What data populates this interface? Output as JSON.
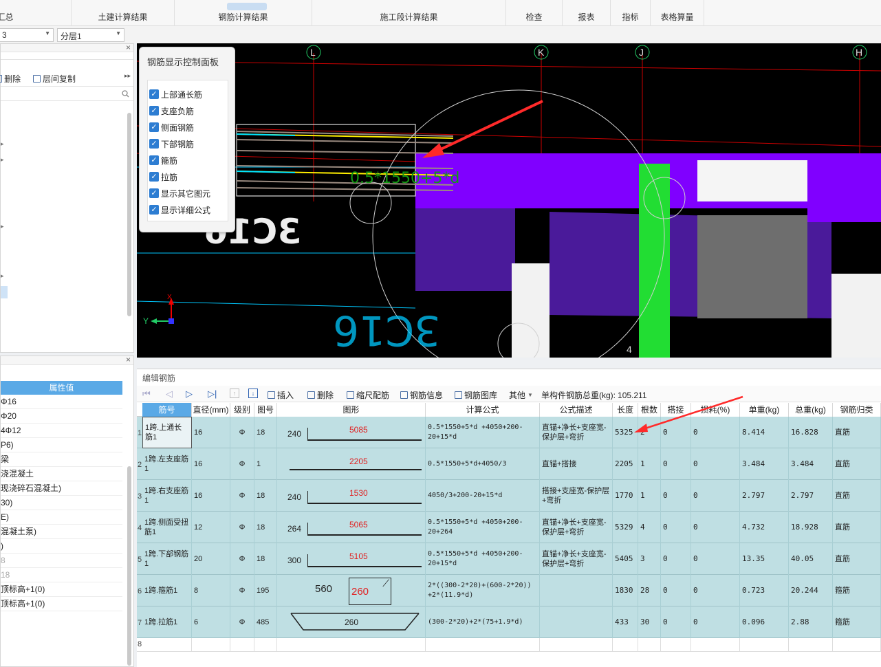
{
  "ribbon": {
    "tabs": [
      "汇总",
      "土建计算结果",
      "钢筋计算结果",
      "施工段计算结果",
      "检查",
      "报表",
      "指标",
      "表格算量"
    ]
  },
  "toolbar2": {
    "floor_select": "3",
    "layer_select": "分层1"
  },
  "left_panel_top": {
    "delete_label": "删除",
    "copy_label": "层间复制"
  },
  "left_panel_bottom": {
    "header": "属性值",
    "values": [
      "Φ16",
      "Φ20",
      "4Φ12",
      "P6)",
      "梁",
      "浇混凝土",
      "现浇碎石混凝土)",
      "30)",
      "E)",
      "混凝土泵)",
      ")",
      "8",
      "18",
      "顶标高+1(0)",
      "顶标高+1(0)"
    ]
  },
  "viewport": {
    "axis_labels": [
      "L",
      "K",
      "J",
      "H"
    ],
    "rebar_text_1": "3C16",
    "rebar_text_2": "3C16",
    "annot_green": "0.5*1550+5*d",
    "axis_y": "Y",
    "axis_x": "X",
    "bottom_label": "4"
  },
  "control_panel": {
    "title": "钢筋显示控制面板",
    "items": [
      "上部通长筋",
      "支座负筋",
      "侧面钢筋",
      "下部钢筋",
      "箍筋",
      "拉筋",
      "显示其它图元",
      "显示详细公式"
    ]
  },
  "editor": {
    "title": "编辑钢筋",
    "buttons": {
      "insert": "插入",
      "delete": "删除",
      "scale": "缩尺配筋",
      "info": "钢筋信息",
      "library": "钢筋图库",
      "other": "其他"
    },
    "total_weight_label": "单构件钢筋总重(kg):",
    "total_weight": "105.211",
    "columns": [
      "筋号",
      "直径(mm)",
      "级别",
      "图号",
      "图形",
      "计算公式",
      "公式描述",
      "长度",
      "根数",
      "搭接",
      "损耗(%)",
      "单重(kg)",
      "总重(kg)",
      "钢筋归类"
    ],
    "rows": [
      {
        "num": "1",
        "name": "1跨.上通长筋1",
        "dia": "16",
        "grade": "Φ",
        "fig": "18",
        "shape_left": "240",
        "shape_main": "5085",
        "formula": "0.5*1550+5*d +4050+200-20+15*d",
        "desc": "直锚+净长+支座宽-保护层+弯折",
        "len": "5325",
        "count": "2",
        "lap": "0",
        "loss": "0",
        "unit": "8.414",
        "total": "16.828",
        "cls": "直筋"
      },
      {
        "num": "2",
        "name": "1跨.左支座筋1",
        "dia": "16",
        "grade": "Φ",
        "fig": "1",
        "shape_left": "",
        "shape_main": "2205",
        "formula": "0.5*1550+5*d+4050/3",
        "desc": "直锚+搭接",
        "len": "2205",
        "count": "1",
        "lap": "0",
        "loss": "0",
        "unit": "3.484",
        "total": "3.484",
        "cls": "直筋"
      },
      {
        "num": "3",
        "name": "1跨.右支座筋1",
        "dia": "16",
        "grade": "Φ",
        "fig": "18",
        "shape_left": "240",
        "shape_main": "1530",
        "formula": "4050/3+200-20+15*d",
        "desc": "搭接+支座宽-保护层+弯折",
        "len": "1770",
        "count": "1",
        "lap": "0",
        "loss": "0",
        "unit": "2.797",
        "total": "2.797",
        "cls": "直筋"
      },
      {
        "num": "4",
        "name": "1跨.侧面受扭筋1",
        "dia": "12",
        "grade": "Φ",
        "fig": "18",
        "shape_left": "264",
        "shape_main": "5065",
        "formula": "0.5*1550+5*d +4050+200-20+264",
        "desc": "直锚+净长+支座宽-保护层+弯折",
        "len": "5329",
        "count": "4",
        "lap": "0",
        "loss": "0",
        "unit": "4.732",
        "total": "18.928",
        "cls": "直筋"
      },
      {
        "num": "5",
        "name": "1跨.下部钢筋1",
        "dia": "20",
        "grade": "Φ",
        "fig": "18",
        "shape_left": "300",
        "shape_main": "5105",
        "formula": "0.5*1550+5*d +4050+200-20+15*d",
        "desc": "直锚+净长+支座宽-保护层+弯折",
        "len": "5405",
        "count": "3",
        "lap": "0",
        "loss": "0",
        "unit": "13.35",
        "total": "40.05",
        "cls": "直筋"
      },
      {
        "num": "6",
        "name": "1跨.箍筋1",
        "dia": "8",
        "grade": "Φ",
        "fig": "195",
        "shape_left": "560",
        "shape_main": "260",
        "formula": "2*((300-2*20)+(600-2*20)) +2*(11.9*d)",
        "desc": "",
        "len": "1830",
        "count": "28",
        "lap": "0",
        "loss": "0",
        "unit": "0.723",
        "total": "20.244",
        "cls": "箍筋"
      },
      {
        "num": "7",
        "name": "1跨.拉筋1",
        "dia": "6",
        "grade": "Φ",
        "fig": "485",
        "shape_left": "",
        "shape_main": "260",
        "formula": "(300-2*20)+2*(75+1.9*d)",
        "desc": "",
        "len": "433",
        "count": "30",
        "lap": "0",
        "loss": "0",
        "unit": "0.096",
        "total": "2.88",
        "cls": "箍筋"
      }
    ],
    "empty_row_num": "8"
  },
  "colors": {
    "viewport_bg": "#000000",
    "purple": "#8000ff",
    "dark_purple": "#4a1a9a",
    "green_column": "#22dd33",
    "row_bg": "#bfdfe3",
    "selected_header": "#5aa9e6"
  }
}
